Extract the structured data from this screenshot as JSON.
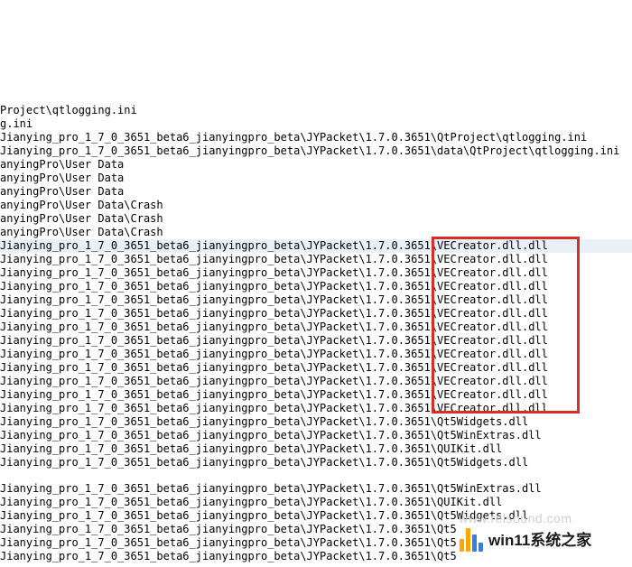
{
  "lines": [
    {
      "type": "line",
      "text": "Project\\qtlogging.ini"
    },
    {
      "type": "line",
      "text": "g.ini"
    },
    {
      "type": "line",
      "text": "Jianying_pro_1_7_0_3651_beta6_jianyingpro_beta\\JYPacket\\1.7.0.3651\\QtProject\\qtlogging.ini"
    },
    {
      "type": "line",
      "text": "Jianying_pro_1_7_0_3651_beta6_jianyingpro_beta\\JYPacket\\1.7.0.3651\\data\\QtProject\\qtlogging.ini"
    },
    {
      "type": "line",
      "text": "anyingPro\\User Data"
    },
    {
      "type": "line",
      "text": "anyingPro\\User Data"
    },
    {
      "type": "line",
      "text": "anyingPro\\User Data"
    },
    {
      "type": "line",
      "text": "anyingPro\\User Data\\Crash"
    },
    {
      "type": "line",
      "text": "anyingPro\\User Data\\Crash"
    },
    {
      "type": "line",
      "text": "anyingPro\\User Data\\Crash"
    },
    {
      "type": "line",
      "text": "Jianying_pro_1_7_0_3651_beta6_jianyingpro_beta\\JYPacket\\1.7.0.3651\\VECreator.dll.dll",
      "highlight": true
    },
    {
      "type": "line",
      "text": "Jianying_pro_1_7_0_3651_beta6_jianyingpro_beta\\JYPacket\\1.7.0.3651\\VECreator.dll.dll"
    },
    {
      "type": "line",
      "text": "Jianying_pro_1_7_0_3651_beta6_jianyingpro_beta\\JYPacket\\1.7.0.3651\\VECreator.dll.dll"
    },
    {
      "type": "line",
      "text": "Jianying_pro_1_7_0_3651_beta6_jianyingpro_beta\\JYPacket\\1.7.0.3651\\VECreator.dll.dll"
    },
    {
      "type": "line",
      "text": "Jianying_pro_1_7_0_3651_beta6_jianyingpro_beta\\JYPacket\\1.7.0.3651\\VECreator.dll.dll"
    },
    {
      "type": "line",
      "text": "Jianying_pro_1_7_0_3651_beta6_jianyingpro_beta\\JYPacket\\1.7.0.3651\\VECreator.dll.dll"
    },
    {
      "type": "line",
      "text": "Jianying_pro_1_7_0_3651_beta6_jianyingpro_beta\\JYPacket\\1.7.0.3651\\VECreator.dll.dll"
    },
    {
      "type": "line",
      "text": "Jianying_pro_1_7_0_3651_beta6_jianyingpro_beta\\JYPacket\\1.7.0.3651\\VECreator.dll.dll"
    },
    {
      "type": "line",
      "text": "Jianying_pro_1_7_0_3651_beta6_jianyingpro_beta\\JYPacket\\1.7.0.3651\\VECreator.dll.dll"
    },
    {
      "type": "line",
      "text": "Jianying_pro_1_7_0_3651_beta6_jianyingpro_beta\\JYPacket\\1.7.0.3651\\VECreator.dll.dll"
    },
    {
      "type": "line",
      "text": "Jianying_pro_1_7_0_3651_beta6_jianyingpro_beta\\JYPacket\\1.7.0.3651\\VECreator.dll.dll"
    },
    {
      "type": "line",
      "text": "Jianying_pro_1_7_0_3651_beta6_jianyingpro_beta\\JYPacket\\1.7.0.3651\\VECreator.dll.dll"
    },
    {
      "type": "line",
      "text": "Jianying_pro_1_7_0_3651_beta6_jianyingpro_beta\\JYPacket\\1.7.0.3651\\VECreator.dll.dll"
    },
    {
      "type": "line",
      "text": "Jianying_pro_1_7_0_3651_beta6_jianyingpro_beta\\JYPacket\\1.7.0.3651\\Qt5Widgets.dll"
    },
    {
      "type": "line",
      "text": "Jianying_pro_1_7_0_3651_beta6_jianyingpro_beta\\JYPacket\\1.7.0.3651\\Qt5WinExtras.dll"
    },
    {
      "type": "line",
      "text": "Jianying_pro_1_7_0_3651_beta6_jianyingpro_beta\\JYPacket\\1.7.0.3651\\QUIKit.dll"
    },
    {
      "type": "line",
      "text": "Jianying_pro_1_7_0_3651_beta6_jianyingpro_beta\\JYPacket\\1.7.0.3651\\Qt5Widgets.dll"
    },
    {
      "type": "gap"
    },
    {
      "type": "line",
      "text": "Jianying_pro_1_7_0_3651_beta6_jianyingpro_beta\\JYPacket\\1.7.0.3651\\Qt5WinExtras.dll"
    },
    {
      "type": "line",
      "text": "Jianying_pro_1_7_0_3651_beta6_jianyingpro_beta\\JYPacket\\1.7.0.3651\\QUIKit.dll"
    },
    {
      "type": "line",
      "text": "Jianying_pro_1_7_0_3651_beta6_jianyingpro_beta\\JYPacket\\1.7.0.3651\\Qt5Widgets.dll"
    },
    {
      "type": "line",
      "text": "Jianying_pro_1_7_0_3651_beta6_jianyingpro_beta\\JYPacket\\1.7.0.3651\\Qt5"
    },
    {
      "type": "line",
      "text": "Jianying_pro_1_7_0_3651_beta6_jianyingpro_beta\\JYPacket\\1.7.0.3651\\Qt5"
    },
    {
      "type": "line",
      "text": "Jianying_pro_1_7_0_3651_beta6_jianyingpro_beta\\JYPacket\\1.7.0.3651\\Qt5"
    }
  ],
  "watermark": "www.relsound.com",
  "logo_text": "win11系统之家"
}
